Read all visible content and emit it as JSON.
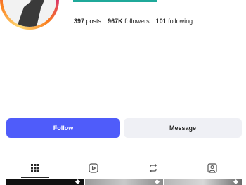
{
  "profile": {
    "stats": [
      {
        "value": "397",
        "label": "posts"
      },
      {
        "value": "967K",
        "label": "followers"
      },
      {
        "value": "101",
        "label": "following"
      }
    ]
  },
  "actions": {
    "follow_label": "Follow",
    "message_label": "Message"
  },
  "tabs": [
    {
      "name": "grid-icon",
      "active": true
    },
    {
      "name": "reels-play-icon",
      "active": false
    },
    {
      "name": "repost-icon",
      "active": false
    },
    {
      "name": "tagged-user-icon",
      "active": false
    }
  ],
  "colors": {
    "accent": "#4f5cfa",
    "secondary_button": "#eff0f5",
    "teal_bar": "#1fa99a"
  }
}
